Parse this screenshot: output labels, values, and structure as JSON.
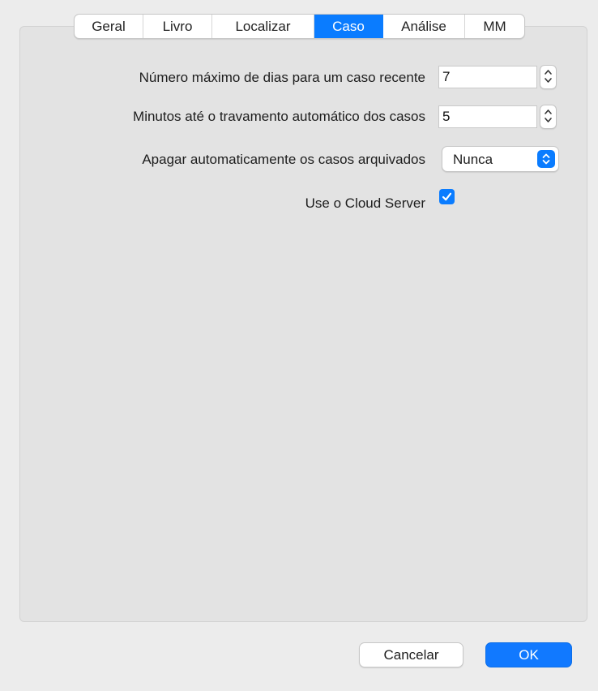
{
  "tabs": [
    {
      "label": "Geral",
      "active": false
    },
    {
      "label": "Livro",
      "active": false
    },
    {
      "label": "Localizar",
      "active": false
    },
    {
      "label": "Caso",
      "active": true
    },
    {
      "label": "Análise",
      "active": false
    },
    {
      "label": "MM",
      "active": false
    }
  ],
  "settings": {
    "recent_days": {
      "label": "Número máximo de dias para um caso recente",
      "value": "7"
    },
    "lock_minutes": {
      "label": "Minutos até o travamento automático dos casos",
      "value": "5"
    },
    "auto_delete": {
      "label": "Apagar automaticamente os casos arquivados",
      "selected": "Nunca"
    },
    "cloud_server": {
      "label": "Use o Cloud Server",
      "checked": true
    }
  },
  "buttons": {
    "cancel_label": "Cancelar",
    "ok_label": "OK"
  },
  "colors": {
    "accent": "#0a7cff",
    "panel": "#e3e3e3",
    "window": "#ececec"
  },
  "icons": {
    "stepper": "stepper-arrows-icon",
    "select": "chevron-updown-icon",
    "checkbox": "checkmark-icon"
  }
}
